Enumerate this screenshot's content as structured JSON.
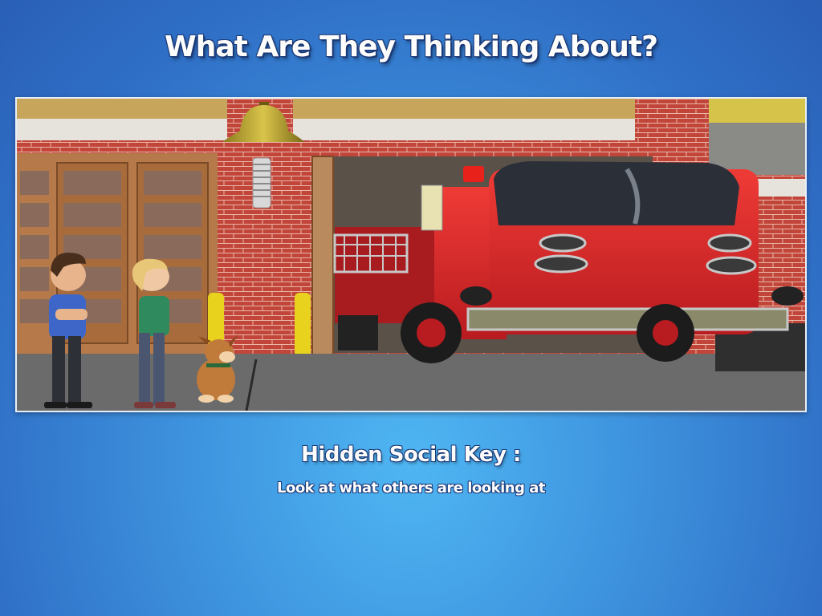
{
  "slide": {
    "title": "What Are They Thinking About?",
    "key_label": "Hidden Social Key :",
    "key_text": "Look at what others are looking at"
  },
  "scene": {
    "elements": [
      "boy",
      "girl",
      "dog",
      "bell",
      "fire-truck",
      "fire-station"
    ]
  },
  "colors": {
    "background": "#3f96e0",
    "brick": "#c2453a",
    "truck": "#d8262a"
  }
}
